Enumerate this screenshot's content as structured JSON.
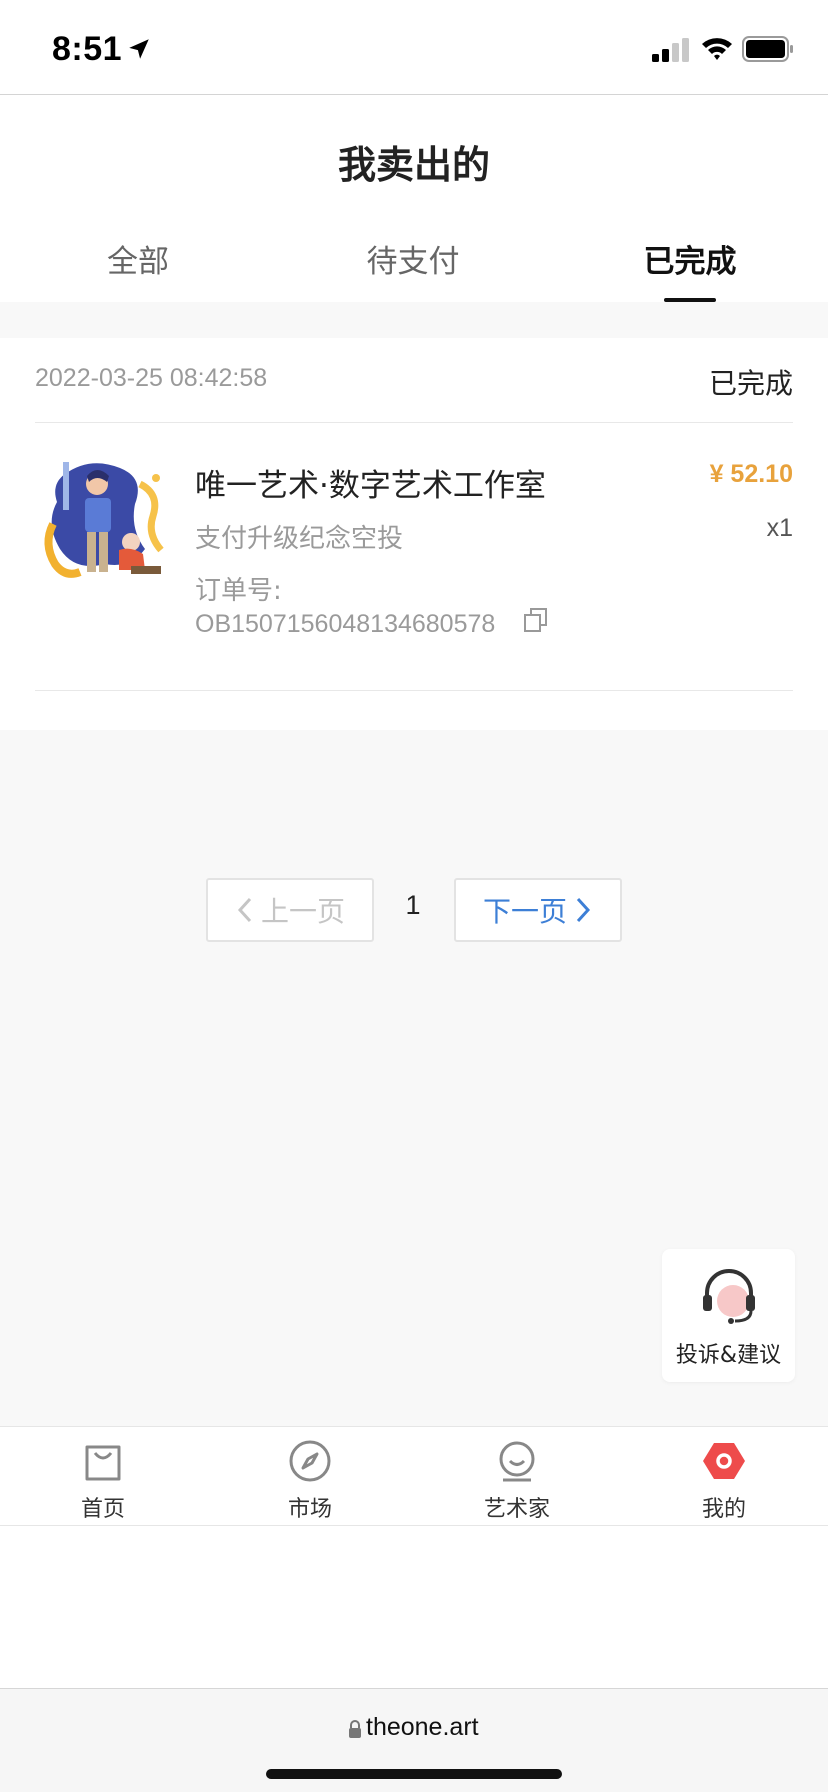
{
  "status_bar": {
    "time": "8:51",
    "icons": [
      "location-arrow-icon",
      "signal-icon",
      "wifi-icon",
      "battery-icon"
    ]
  },
  "header": {
    "title": "我卖出的",
    "tabs": [
      {
        "label": "全部",
        "active": false
      },
      {
        "label": "待支付",
        "active": false
      },
      {
        "label": "已完成",
        "active": true
      }
    ]
  },
  "order": {
    "date": "2022-03-25 08:42:58",
    "status": "已完成",
    "item_name": "唯一艺术·数字艺术工作室",
    "price": "¥ 52.10",
    "quantity": "x1",
    "description": "支付升级纪念空投",
    "order_no_label": "订单号:",
    "order_no": "OB1507156048134680578"
  },
  "pagination": {
    "prev_label": "上一页",
    "current_page": "1",
    "next_label": "下一页"
  },
  "feedback": {
    "label": "投诉&建议"
  },
  "tab_bar": {
    "items": [
      {
        "label": "首页",
        "icon": "shopping-bag-icon",
        "active": false
      },
      {
        "label": "市场",
        "icon": "compass-icon",
        "active": false
      },
      {
        "label": "艺术家",
        "icon": "artist-icon",
        "active": false
      },
      {
        "label": "我的",
        "icon": "profile-hexagon-icon",
        "active": true
      }
    ]
  },
  "browser": {
    "url": "theone.art"
  },
  "colors": {
    "price": "#e8a23c",
    "next_link": "#3d7fd6",
    "active_tab_icon": "#ee4b4b",
    "page_bg": "#f8f8f8"
  }
}
